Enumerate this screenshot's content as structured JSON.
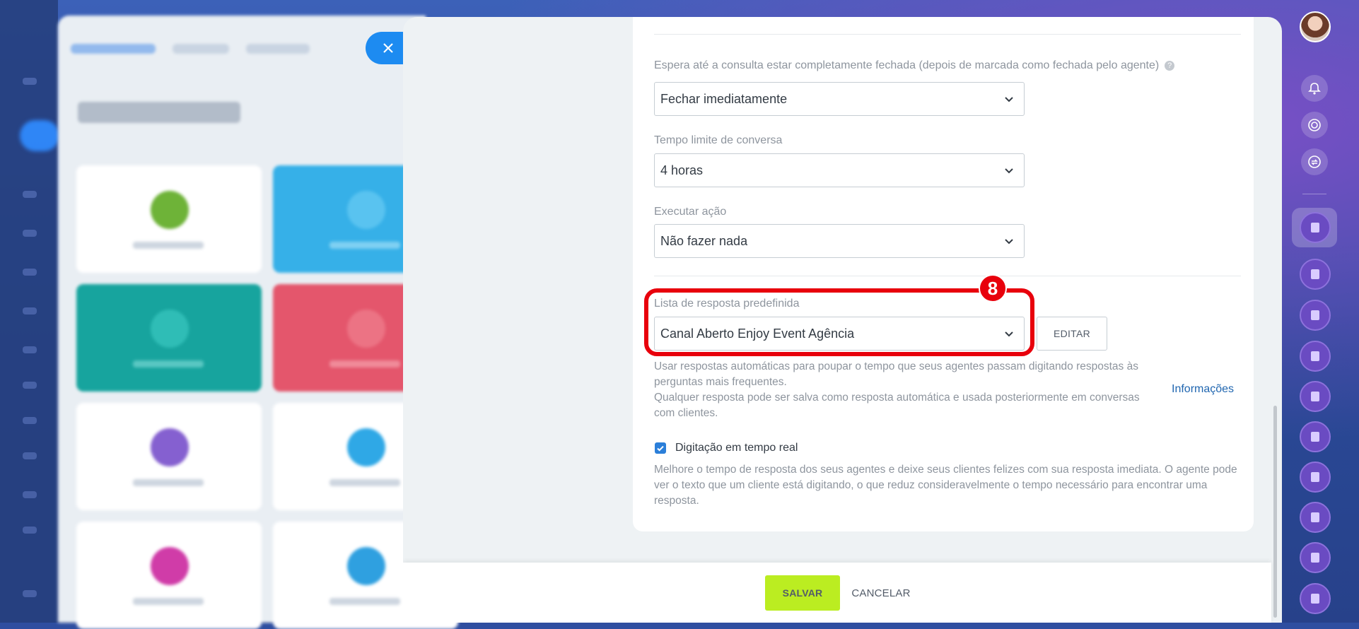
{
  "form": {
    "wait_label": "Espera até a consulta estar completamente fechada (depois de marcada como fechada pelo agente)",
    "wait_value": "Fechar imediatamente",
    "timeout_label": "Tempo limite de conversa",
    "timeout_value": "4 horas",
    "action_label": "Executar ação",
    "action_value": "Não fazer nada",
    "answers_label": "Lista de resposta predefinida",
    "answers_value": "Canal Aberto Enjoy Event Agência",
    "edit_label": "EDITAR",
    "answers_hint_1": "Usar respostas automáticas para poupar o tempo que seus agentes passam digitando respostas às perguntas mais frequentes.",
    "answers_hint_2": "Qualquer resposta pode ser salva como resposta automática e usada posteriormente em conversas com clientes.",
    "info_link": "Informações",
    "realtime_label": "Digitação em tempo real",
    "realtime_checked": true,
    "realtime_hint": "Melhore o tempo de resposta dos seus agentes e deixe seus clientes felizes com sua resposta imediata. O agente pode ver o texto que um cliente está digitando, o que reduz consideravelmente o tempo necessário para encontrar uma resposta."
  },
  "annotation": {
    "step_number": "8",
    "color": "#e8000c"
  },
  "footer": {
    "save_label": "SALVAR",
    "cancel_label": "CANCELAR"
  },
  "icons": {
    "close": "close-icon",
    "notifications": "bell-icon",
    "rail_2": "target-icon",
    "rail_3": "sync-icon",
    "chat": "chat-channel-icon"
  },
  "colors": {
    "accent": "#1d8bf1",
    "save": "#bbed21",
    "link": "#2066b0"
  }
}
